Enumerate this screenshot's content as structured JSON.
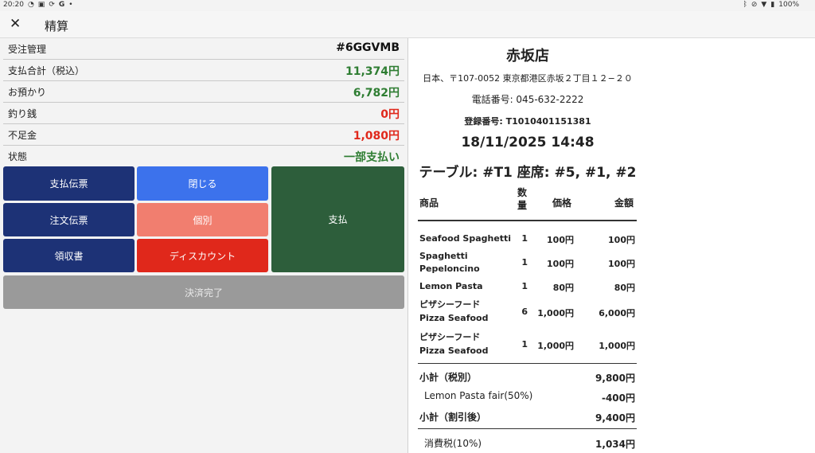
{
  "statusbar": {
    "time": "20:20",
    "battery": "100%"
  },
  "appbar": {
    "title": "精算",
    "close_label": "✕"
  },
  "info_rows": [
    {
      "label": "受注管理",
      "value": "#6GGVMB",
      "color": "dark"
    },
    {
      "label": "支払合計（税込）",
      "value": "11,374円",
      "color": "green"
    },
    {
      "label": "お預かり",
      "value": "6,782円",
      "color": "green"
    },
    {
      "label": "釣り銭",
      "value": "0円",
      "color": "red"
    },
    {
      "label": "不足金",
      "value": "1,080円",
      "color": "red"
    },
    {
      "label": "状態",
      "value": "一部支払い",
      "color": "green"
    }
  ],
  "buttons": {
    "payment_slip": "支払伝票",
    "close": "閉じる",
    "pay": "支払",
    "order_slip": "注文伝票",
    "individual": "個別",
    "receipt": "領収書",
    "discount": "ディスカウント",
    "complete": "決済完了"
  },
  "receipt": {
    "shop_name": "赤坂店",
    "address": "日本、〒107-0052 東京都港区赤坂２丁目１２−２０",
    "phone": "電話番号: 045-632-2222",
    "registration": "登録番号: T1010401151381",
    "datetime": "18/11/2025 14:48",
    "table_seat": "テーブル: #T1  座席: #5, #1, #2",
    "headers": {
      "item": "商品",
      "qty": "数\n量",
      "price": "価格",
      "amount": "金額"
    },
    "items": [
      {
        "name": "Seafood Spaghetti",
        "qty": "1",
        "price": "100円",
        "amount": "100円"
      },
      {
        "name": "Spaghetti\nPepeloncino",
        "qty": "1",
        "price": "100円",
        "amount": "100円"
      },
      {
        "name": "Lemon Pasta",
        "qty": "1",
        "price": "80円",
        "amount": "80円"
      },
      {
        "name": "ピザシーフード\nPizza Seafood",
        "qty": "6",
        "price": "1,000円",
        "amount": "6,000円"
      },
      {
        "name": "ピザシーフード\nPizza Seafood",
        "qty": "1",
        "price": "1,000円",
        "amount": "1,000円"
      }
    ],
    "subtotal_label": "小計（税別）",
    "subtotal_value": "9,800円",
    "discount_label": "Lemon Pasta fair(50%)",
    "discount_value": "-400円",
    "subtotal_after_label": "小計（割引後）",
    "subtotal_after_value": "9,400円",
    "tax_label": "消費税(10%)",
    "tax_value": "1,034円"
  }
}
